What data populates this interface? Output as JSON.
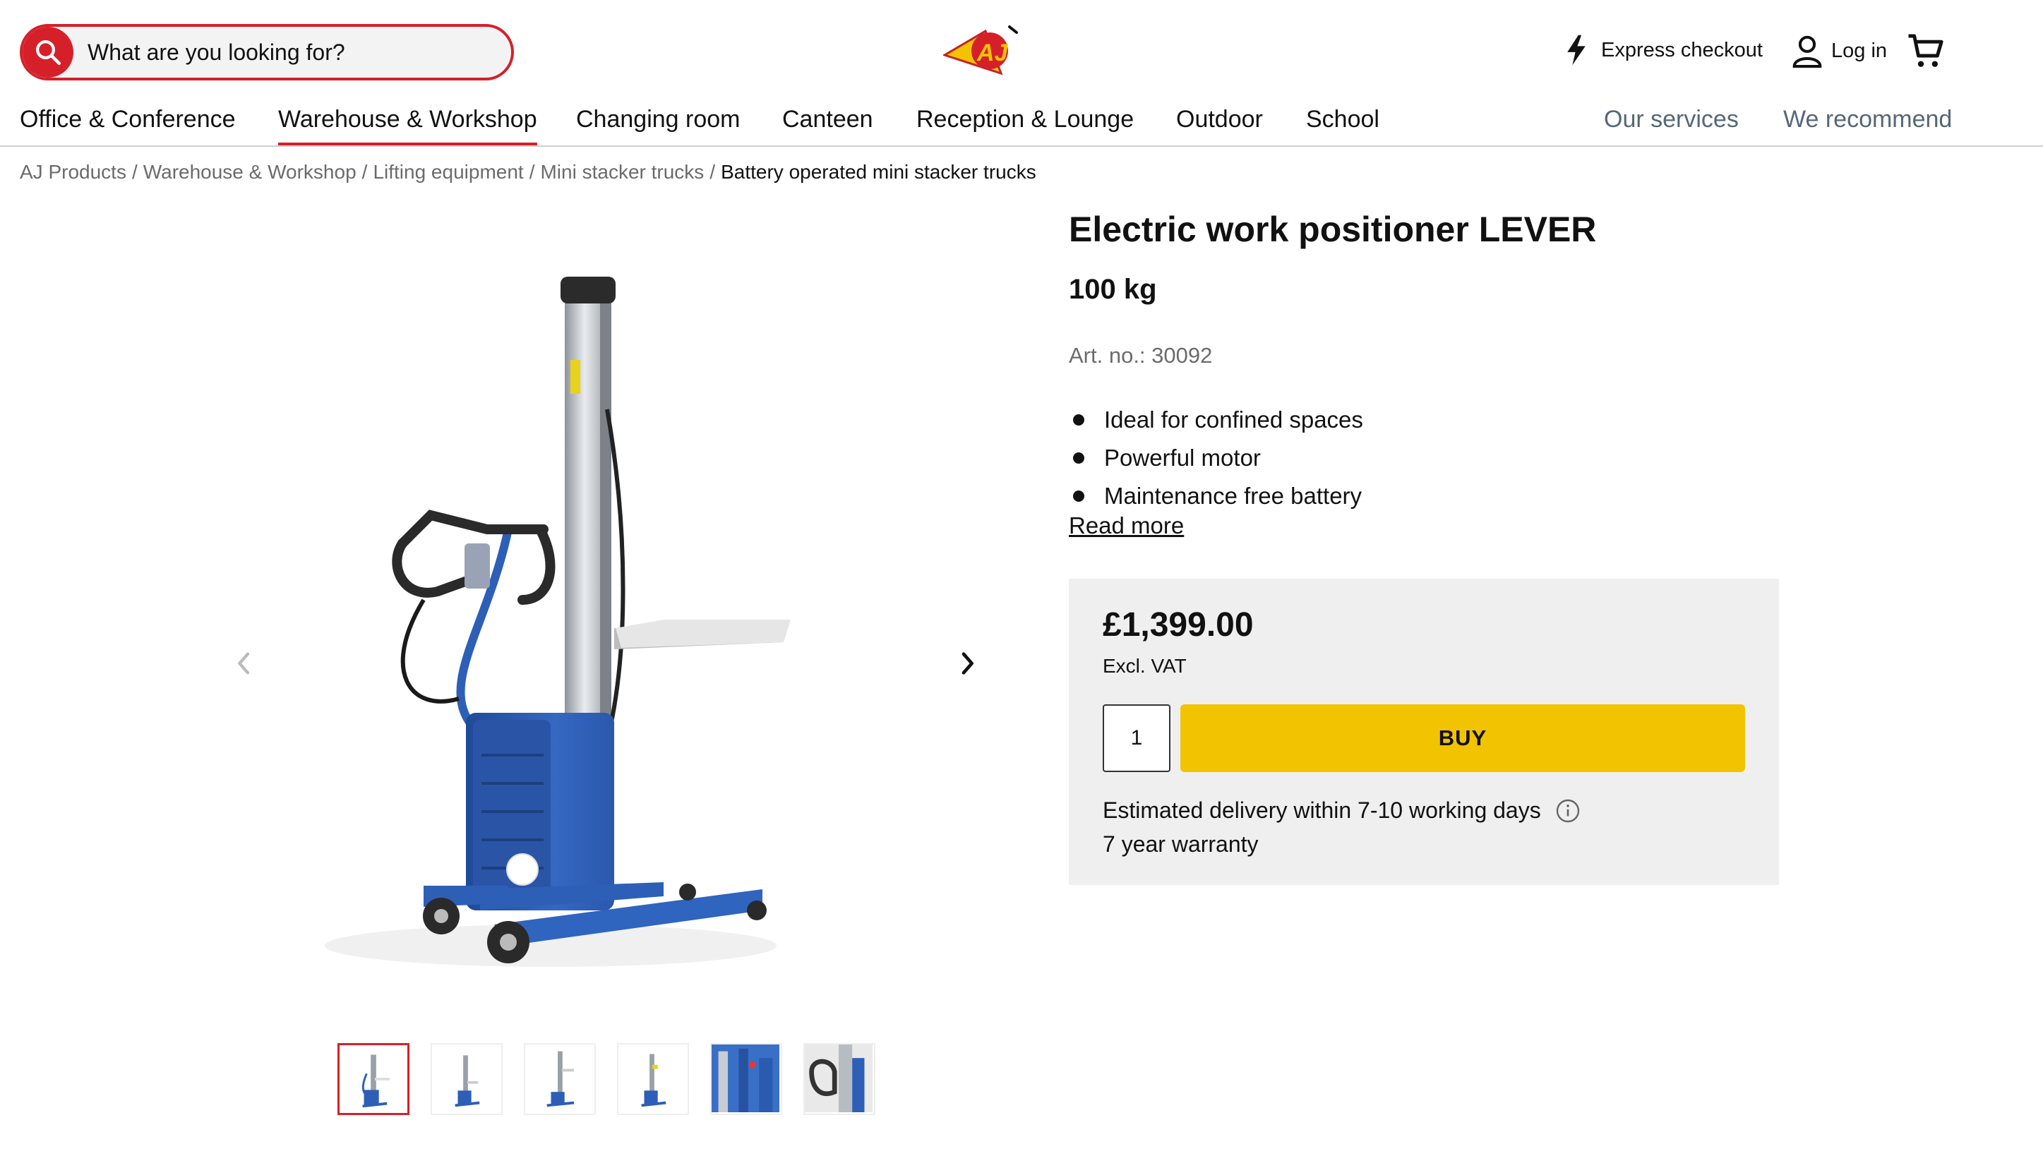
{
  "search": {
    "placeholder": "What are you looking for?"
  },
  "header": {
    "express_label": "Express checkout",
    "login_label": "Log in"
  },
  "nav": {
    "items": [
      {
        "label": "Office & Conference"
      },
      {
        "label": "Warehouse & Workshop",
        "active": true
      },
      {
        "label": "Changing room"
      },
      {
        "label": "Canteen"
      },
      {
        "label": "Reception & Lounge"
      },
      {
        "label": "Outdoor"
      },
      {
        "label": "School"
      }
    ],
    "right": [
      {
        "label": "Our services"
      },
      {
        "label": "We recommend"
      }
    ]
  },
  "breadcrumb": {
    "items": [
      "AJ Products",
      "Warehouse & Workshop",
      "Lifting equipment",
      "Mini stacker trucks"
    ],
    "separator": "/",
    "current": "Battery operated mini stacker trucks"
  },
  "product": {
    "title": "Electric work positioner LEVER",
    "subtitle": "100 kg",
    "art_no": "Art. no.: 30092",
    "bullets": [
      "Ideal for confined spaces",
      "Powerful motor",
      "Maintenance free battery"
    ],
    "read_more": "Read more",
    "price": "£1,399.00",
    "vat_note": "Excl. VAT",
    "quantity": "1",
    "buy_label": "BUY",
    "delivery": "Estimated delivery within 7-10 working days",
    "warranty": "7 year warranty"
  },
  "colors": {
    "brand_red": "#d5202a",
    "buy_yellow": "#f2c300",
    "machine_blue": "#2f5fb3",
    "buybox_bg": "#efefef"
  },
  "gallery": {
    "thumbnail_count": 6,
    "active_index": 0
  }
}
